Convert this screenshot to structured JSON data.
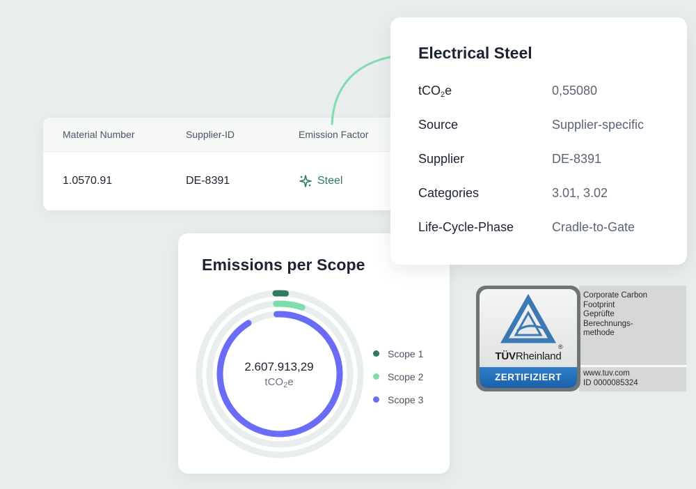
{
  "table": {
    "headers": [
      "Material Number",
      "Supplier-ID",
      "Emission Factor"
    ],
    "row": {
      "material_number": "1.0570.91",
      "supplier_id": "DE-8391",
      "emission_factor": "Steel"
    }
  },
  "detail": {
    "title": "Electrical Steel",
    "rows": [
      {
        "label_main": "tCO",
        "label_sub": "2",
        "label_tail": "e",
        "value": "0,55080"
      },
      {
        "label": "Source",
        "value": "Supplier-specific"
      },
      {
        "label": "Supplier",
        "value": "DE-8391"
      },
      {
        "label": "Categories",
        "value": "3.01, 3.02"
      },
      {
        "label": "Life-Cycle-Phase",
        "value": "Cradle-to-Gate"
      }
    ]
  },
  "emissions": {
    "title": "Emissions per Scope",
    "total": "2.607.913,29",
    "unit_main": "tCO",
    "unit_sub": "2",
    "unit_tail": "e",
    "legend": [
      {
        "label": "Scope 1",
        "color": "#2f7a62"
      },
      {
        "label": "Scope 2",
        "color": "#7fdcae"
      },
      {
        "label": "Scope 3",
        "color": "#6b6cf5"
      }
    ]
  },
  "chart_data": {
    "type": "pie",
    "variant": "concentric-rings",
    "categories": [
      "Scope 1",
      "Scope 2",
      "Scope 3"
    ],
    "series": [
      {
        "name": "Scope 1",
        "share": 0.02,
        "color": "#2f7a62"
      },
      {
        "name": "Scope 2",
        "share": 0.06,
        "color": "#7fdcae"
      },
      {
        "name": "Scope 3",
        "share": 0.92,
        "color": "#6b6cf5"
      }
    ],
    "total_label": "2.607.913,29"
  },
  "badge": {
    "brand_bold": "TÜV",
    "brand_light": "Rheinland",
    "registered": "®",
    "certified": "ZERTIFIZIERT",
    "info_lines": [
      "Corporate Carbon",
      "Footprint",
      "Geprüfte",
      "Berechnungs-",
      "methode"
    ],
    "website": "www.tuv.com",
    "id_line": "ID  0000085324"
  },
  "colors": {
    "background": "#e9eded",
    "accent_green": "#7fdcae",
    "steel_green": "#2e7d5a",
    "ring_track": "#e8eded"
  }
}
